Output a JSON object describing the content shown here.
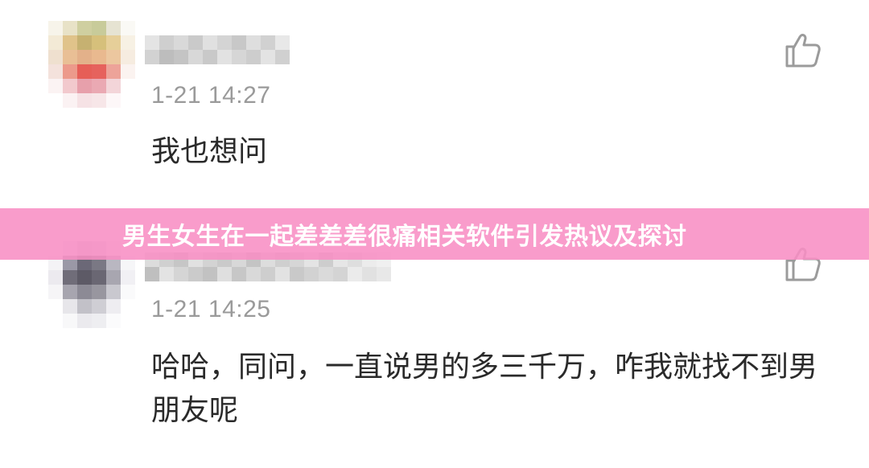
{
  "banner": {
    "title": "男生女生在一起差差差很痛相关软件引发热议及探讨",
    "background_color": "#f88ec4"
  },
  "comments": [
    {
      "time": "1-21 14:27",
      "text": "我也想问",
      "like_icon": "thumbs-up-icon"
    },
    {
      "time": "1-21 14:25",
      "text": "哈哈，同问，一直说男的多三千万，咋我就找不到男朋友呢",
      "like_icon": "thumbs-up-icon"
    }
  ],
  "colors": {
    "time_text": "#9a9a9a",
    "body_text": "#2a2a2a",
    "banner_text": "#ffffff"
  }
}
